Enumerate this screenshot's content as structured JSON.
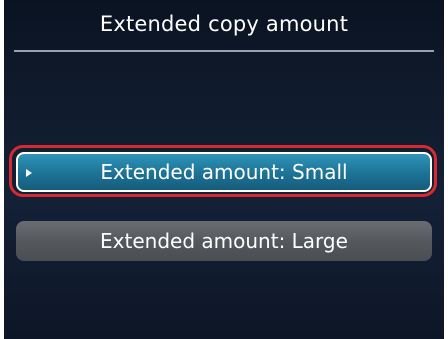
{
  "header": {
    "title": "Extended copy amount"
  },
  "options": [
    {
      "label": "Extended amount: Small",
      "selected": true
    },
    {
      "label": "Extended amount: Large",
      "selected": false
    }
  ],
  "colors": {
    "selected_fill": "#1d7295",
    "normal_fill": "#55585d",
    "highlight_ring": "#d62a33",
    "background": "#101b2c"
  },
  "icons": {
    "cursor": "play-triangle-icon"
  }
}
